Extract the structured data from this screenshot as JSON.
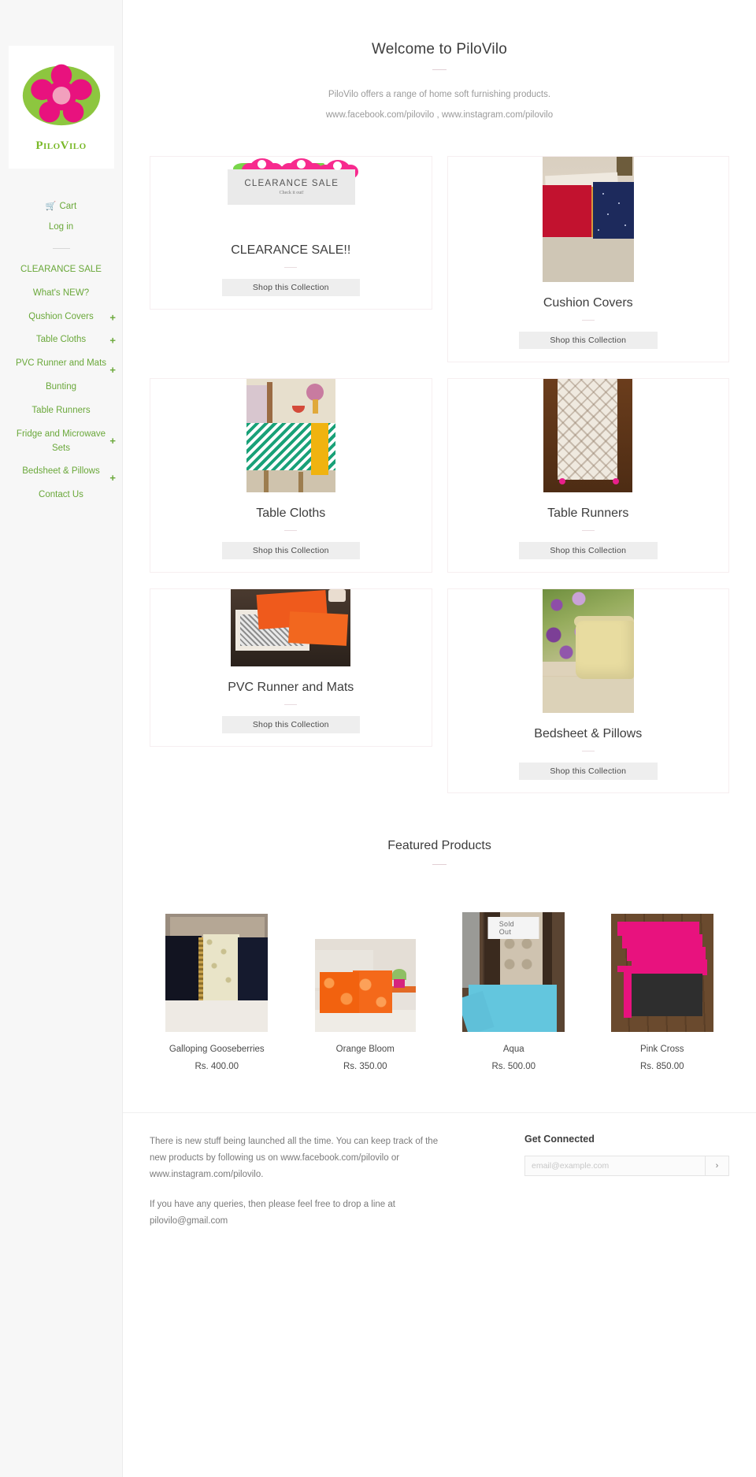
{
  "sidebar": {
    "logo": {
      "name": "PiloVilo",
      "icon": "flower-logo",
      "green": "#8dc63f",
      "pink": "#e8127e"
    },
    "top_links": [
      {
        "label": "Cart",
        "icon": "cart-icon"
      },
      {
        "label": "Log in",
        "icon": ""
      }
    ],
    "nav": [
      {
        "label": "CLEARANCE SALE",
        "expandable": false
      },
      {
        "label": "What's NEW?",
        "expandable": false
      },
      {
        "label": "Qushion Covers",
        "expandable": true
      },
      {
        "label": "Table Cloths",
        "expandable": true
      },
      {
        "label": "PVC Runner and Mats",
        "expandable": true
      },
      {
        "label": "Bunting",
        "expandable": false
      },
      {
        "label": "Table Runners",
        "expandable": false
      },
      {
        "label": "Fridge and Microwave Sets",
        "expandable": true
      },
      {
        "label": "Bedsheet & Pillows",
        "expandable": true
      },
      {
        "label": "Contact Us",
        "expandable": false
      }
    ],
    "expand_symbol": "+"
  },
  "hero": {
    "title": "Welcome to PiloVilo",
    "line1": "PiloVilo offers a range of home soft furnishing products.",
    "line2": "www.facebook.com/pilovilo   ,   www.instagram.com/pilovilo"
  },
  "collections": {
    "button_label": "Shop this Collection",
    "items": [
      {
        "title": "CLEARANCE SALE!!",
        "image": "clearance-sale-banner",
        "banner_main": "CLEARANCE SALE",
        "banner_sub": "Check it out!"
      },
      {
        "title": "Cushion Covers",
        "image": "cushion-covers-photo"
      },
      {
        "title": "Table Cloths",
        "image": "table-cloths-photo"
      },
      {
        "title": "Table Runners",
        "image": "table-runners-photo"
      },
      {
        "title": "PVC Runner and Mats",
        "image": "pvc-runner-mats-photo"
      },
      {
        "title": "Bedsheet & Pillows",
        "image": "bedsheet-pillows-photo"
      }
    ]
  },
  "featured": {
    "title": "Featured Products",
    "products": [
      {
        "name": "Galloping Gooseberries",
        "price": "Rs. 400.00",
        "badge": "",
        "image": "galloping-gooseberries-photo"
      },
      {
        "name": "Orange Bloom",
        "price": "Rs. 350.00",
        "badge": "",
        "image": "orange-bloom-photo"
      },
      {
        "name": "Aqua",
        "price": "Rs. 500.00",
        "badge": "Sold Out",
        "image": "aqua-photo"
      },
      {
        "name": "Pink Cross",
        "price": "Rs. 850.00",
        "badge": "",
        "image": "pink-cross-photo"
      }
    ]
  },
  "footer": {
    "text1": "There is new stuff being launched all the time. You can keep track of the new products by following us on www.facebook.com/pilovilo or www.instagram.com/pilovilo.",
    "text2": "If you have any queries, then please feel free to drop a line at pilovilo@gmail.com",
    "connect_title": "Get Connected",
    "email_placeholder": "email@example.com",
    "submit_label": "›"
  }
}
